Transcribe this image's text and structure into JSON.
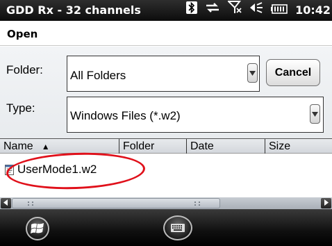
{
  "status_bar": {
    "app_title": "GDD Rx - 32 channels",
    "time": "10:42",
    "icons": [
      "bluetooth-icon",
      "data-connection-icon",
      "no-signal-icon",
      "volume-icon",
      "battery-icon"
    ]
  },
  "dialog": {
    "title": "Open",
    "folder_label": "Folder:",
    "folder_value": "All Folders",
    "type_label": "Type:",
    "type_value": "Windows Files (*.w2)",
    "cancel_label": "Cancel"
  },
  "list": {
    "columns": [
      "Name",
      "Folder",
      "Date",
      "Size"
    ],
    "sort_indicator": "▲",
    "files": [
      {
        "name": "UserMode1.w2",
        "icon": "w2-file-icon"
      }
    ]
  },
  "colors": {
    "highlight_ring": "#e0101a",
    "title_bar": "#1a1a1a",
    "taskbar": "#101010"
  }
}
